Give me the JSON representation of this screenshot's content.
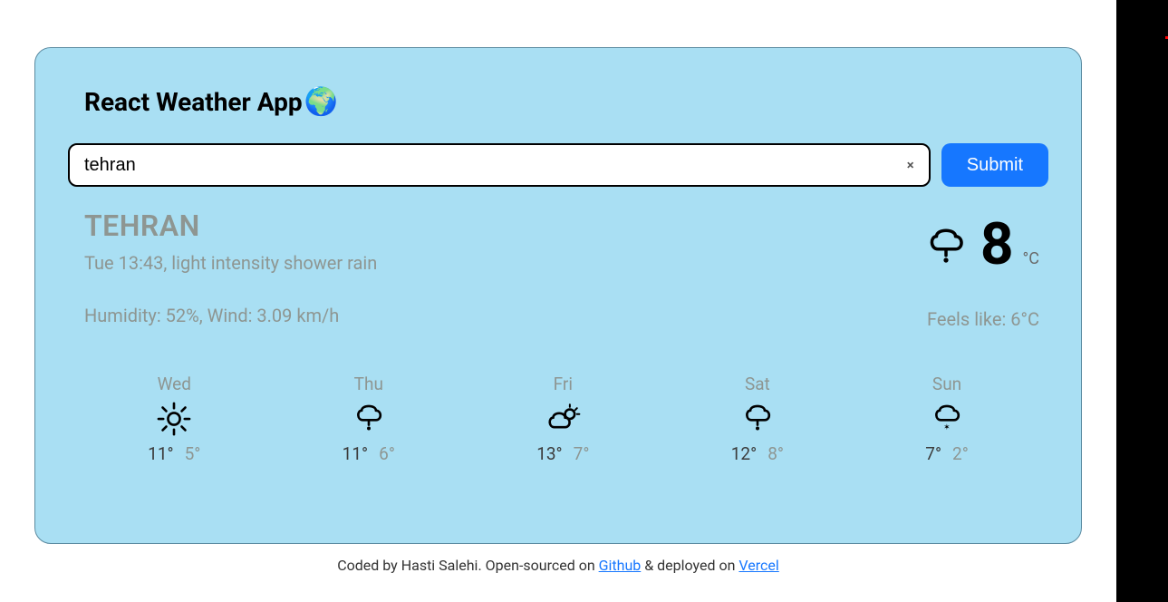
{
  "header": {
    "title": "React Weather App",
    "earth_emoji": "🌍"
  },
  "search": {
    "value": "tehran",
    "clear_label": "×",
    "submit_label": "Submit"
  },
  "current": {
    "city": "TEHRAN",
    "datetime_desc": "Tue 13:43, light intensity shower rain",
    "humidity_wind": "Humidity: 52%, Wind: 3.09 km/h",
    "temp": "8",
    "unit": "°C",
    "feels_like": "Feels like: 6°C",
    "icon": "rain"
  },
  "forecast": [
    {
      "day": "Wed",
      "high": "11°",
      "low": "5°",
      "icon": "sun"
    },
    {
      "day": "Thu",
      "high": "11°",
      "low": "6°",
      "icon": "rain"
    },
    {
      "day": "Fri",
      "high": "13°",
      "low": "7°",
      "icon": "partly"
    },
    {
      "day": "Sat",
      "high": "12°",
      "low": "8°",
      "icon": "rain"
    },
    {
      "day": "Sun",
      "high": "7°",
      "low": "2°",
      "icon": "snow"
    }
  ],
  "footer": {
    "text_pre": "Coded by Hasti Salehi. Open-sourced on ",
    "github_label": "Github",
    "text_mid": " & deployed on ",
    "vercel_label": "Vercel"
  }
}
